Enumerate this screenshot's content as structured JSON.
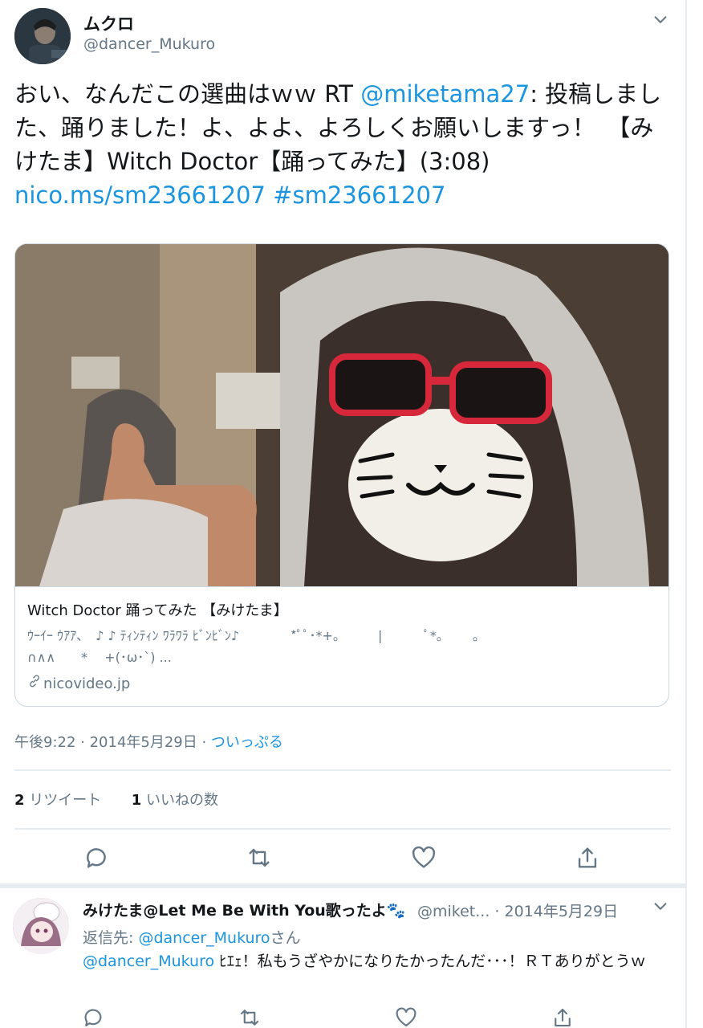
{
  "tweet": {
    "display_name": "ムクロ",
    "handle": "@dancer_Mukuro",
    "text_prefix": "おい、なんだこの選曲はｗｗ RT ",
    "mention": "@miketama27",
    "text_body": ": 投稿しました、踊りました！よ、よよ、よろしくお願いしますっ！　【みけたま】Witch Doctor【踊ってみた】(3:08) ",
    "url": "nico.ms/sm23661207",
    "hashtag": "#sm23661207",
    "timestamp": "午後9:22 · 2014年5月29日 · ",
    "source": "ついっぷる",
    "retweet_count": "2",
    "retweet_label": " リツイート",
    "like_count": "1",
    "like_label": " いいねの数"
  },
  "card": {
    "title": "Witch Doctor 踊ってみた 【みけたま】",
    "description_line1": "ｳｰｲｰ ｳｱｱ、　♪ ♪ ﾃｨﾝﾃｨﾝ ﾜﾗﾜﾗ ﾋﾞﾝﾋﾞﾝ♪　　　　*ﾟﾟ･*+｡　　　|　　　 ﾟ*｡　　 ｡",
    "description_line2": "∩∧∧　　*　 +(･ω･`) ...",
    "domain": "nicovideo.jp"
  },
  "reply": {
    "display_name": "みけたま@Let Me Be With You歌ったよ🐾",
    "handle_date": "@miket...  · 2014年5月29日",
    "reply_to_label": "返信先: ",
    "reply_to_handle": "@dancer_Mukuro",
    "reply_to_suffix": "さん",
    "mention": "@dancer_Mukuro",
    "text": " ﾋｴｪ！私もうざやかになりたかったんだ･･･！ＲＴありがとうｗ"
  },
  "icons": {
    "chevron": "chevron-down-icon",
    "reply": "reply-icon",
    "retweet": "retweet-icon",
    "like": "heart-icon",
    "share": "share-icon",
    "link": "link-icon"
  },
  "colors": {
    "link": "#1b95e0",
    "muted": "#657786",
    "text": "#14171a",
    "border": "#ccd6dd"
  }
}
